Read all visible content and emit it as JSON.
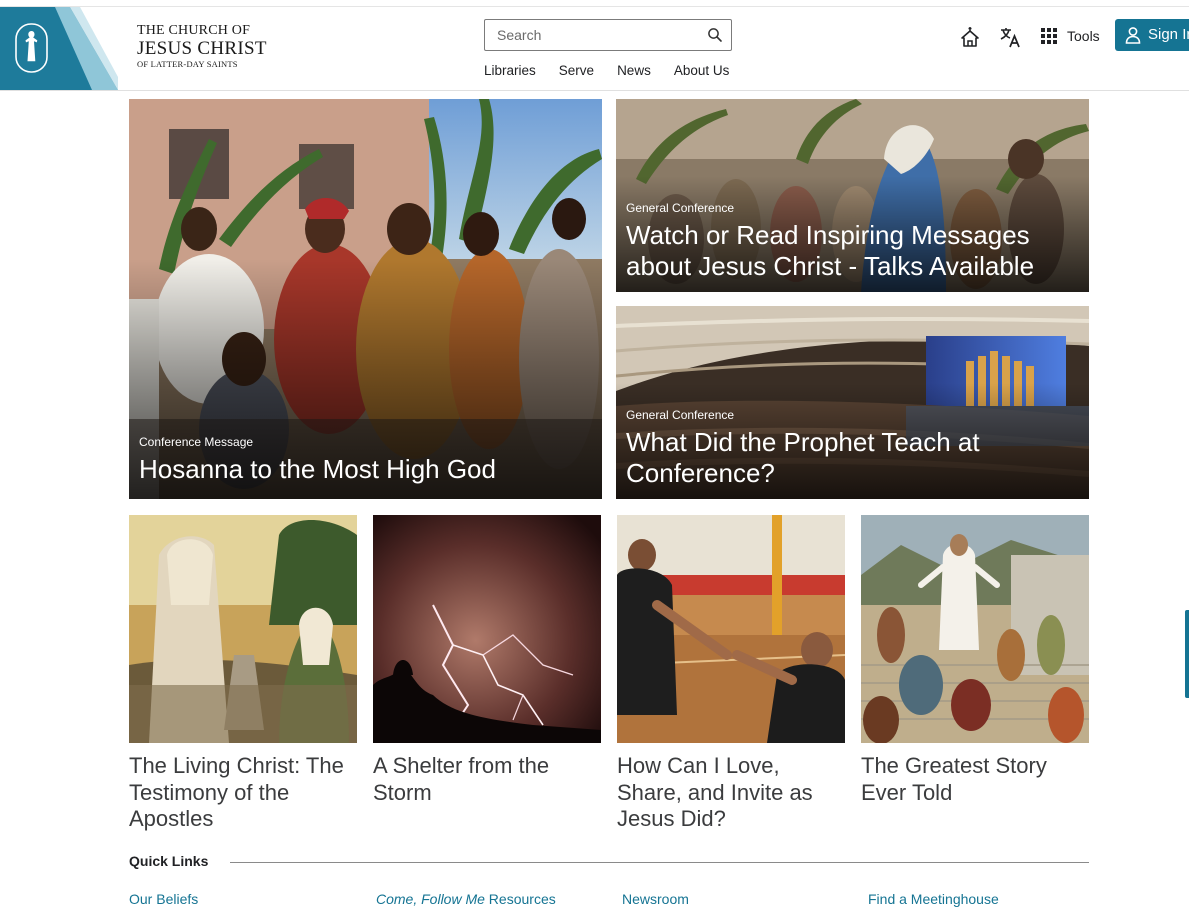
{
  "header": {
    "logo": {
      "line1": "THE CHURCH OF",
      "line2": "JESUS CHRIST",
      "line3": "OF LATTER-DAY SAINTS"
    },
    "search": {
      "placeholder": "Search"
    },
    "nav": [
      "Libraries",
      "Serve",
      "News",
      "About Us"
    ],
    "tools_label": "Tools",
    "signin_label": "Sign In",
    "brand_color": "#157493"
  },
  "features": [
    {
      "kicker": "Conference Message",
      "title": "Hosanna to the Most High God",
      "image": "palm-sunday-procession-photo"
    },
    {
      "kicker": "General Conference",
      "title": "Watch or Read Inspiring Messages about Jesus Christ - Talks Available",
      "image": "jesus-triumphal-entry-painting"
    },
    {
      "kicker": "General Conference",
      "title": "What Did the Prophet Teach at Conference?",
      "image": "conference-center-interior-photo"
    }
  ],
  "cards": [
    {
      "title": "The Living Christ: The Testimony of the Apostles",
      "image": "christ-woman-at-well-painting"
    },
    {
      "title": "A Shelter from the Storm",
      "image": "lightning-storm-photo"
    },
    {
      "title": "How Can I Love, Share, and Invite as Jesus Did?",
      "image": "basketball-helping-hand-photo"
    },
    {
      "title": "The Greatest Story Ever Told",
      "image": "christ-visits-americas-painting"
    }
  ],
  "quick_links": {
    "title": "Quick Links",
    "items": [
      {
        "italic": "",
        "text": "Our Beliefs"
      },
      {
        "italic": "Come, Follow Me",
        "text": " Resources"
      },
      {
        "italic": "",
        "text": "Newsroom"
      },
      {
        "italic": "",
        "text": "Find a Meetinghouse"
      }
    ]
  }
}
